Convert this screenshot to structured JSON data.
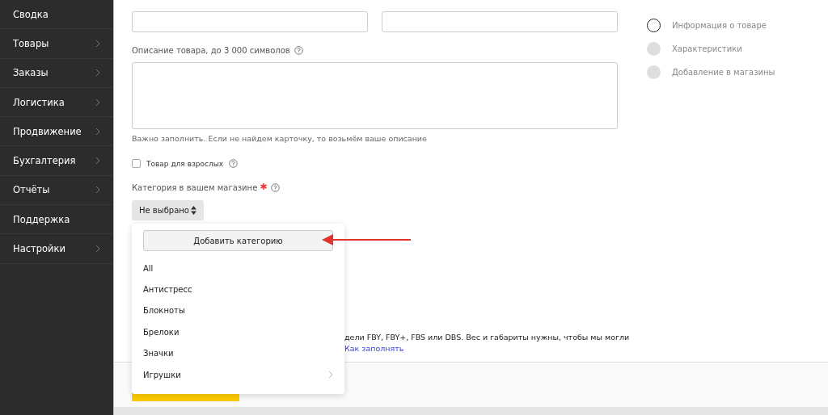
{
  "sidebar": {
    "items": [
      {
        "label": "Сводка",
        "has_submenu": false
      },
      {
        "label": "Товары",
        "has_submenu": true
      },
      {
        "label": "Заказы",
        "has_submenu": true
      },
      {
        "label": "Логистика",
        "has_submenu": true
      },
      {
        "label": "Продвижение",
        "has_submenu": true
      },
      {
        "label": "Бухгалтерия",
        "has_submenu": true
      },
      {
        "label": "Отчёты",
        "has_submenu": true
      },
      {
        "label": "Поддержка",
        "has_submenu": false
      },
      {
        "label": "Настройки",
        "has_submenu": true
      }
    ]
  },
  "form": {
    "description": {
      "label": "Описание товара, до 3 000 символов",
      "hint": "Важно заполнить. Если не найдем карточку, то возьмём ваше описание"
    },
    "adult": {
      "label": "Товар для взрослых",
      "checked": false
    },
    "category": {
      "label": "Категория в вашем магазине",
      "required": true,
      "value": "Не выбрано"
    },
    "delivery_text": "дели FBY, FBY+, FBS или DBS. Вес и габариты нужны, чтобы мы могли",
    "delivery_link": "Как заполнять"
  },
  "dropdown": {
    "add_button": "Добавить категорию",
    "items": [
      {
        "label": "All",
        "has_children": false
      },
      {
        "label": "Антистресс",
        "has_children": false
      },
      {
        "label": "Блокноты",
        "has_children": false
      },
      {
        "label": "Брелоки",
        "has_children": false
      },
      {
        "label": "Значки",
        "has_children": false
      },
      {
        "label": "Игрушки",
        "has_children": true
      }
    ]
  },
  "steps": [
    {
      "label": "Информация о товаре",
      "selected": true
    },
    {
      "label": "Характеристики",
      "selected": false
    },
    {
      "label": "Добавление в магазины",
      "selected": false
    }
  ]
}
